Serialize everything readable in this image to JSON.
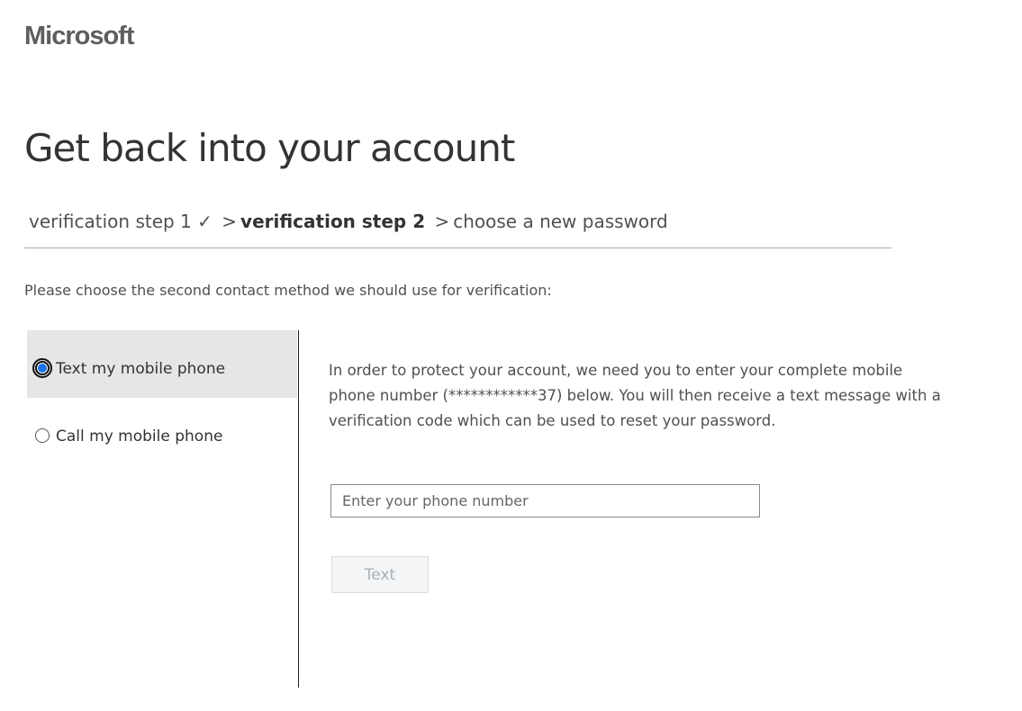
{
  "brand": {
    "logo_text": "Microsoft"
  },
  "page": {
    "title": "Get back into your account"
  },
  "breadcrumb": {
    "step1": "verification step 1 ✓",
    "separator": ">",
    "step2": "verification step 2",
    "step3": "choose a new password"
  },
  "instruction": "Please choose the second contact method we should use for verification:",
  "methods": [
    {
      "label": "Text my mobile phone",
      "selected": true
    },
    {
      "label": "Call my mobile phone",
      "selected": false
    }
  ],
  "detail": {
    "description": "In order to protect your account, we need you to enter your complete mobile phone number (************37) below. You will then receive a text message with a verification code which can be used to reset your password.",
    "phone_input": {
      "placeholder": "Enter your phone number",
      "value": ""
    },
    "submit_label": "Text"
  }
}
